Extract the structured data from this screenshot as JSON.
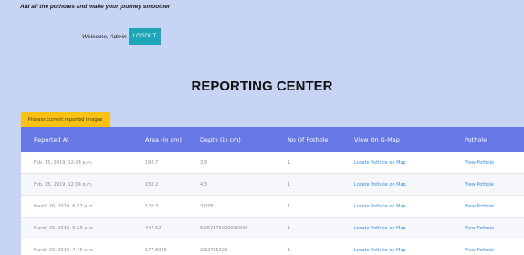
{
  "header": {
    "tagline": "Aid all the potholes and make your journey smoother",
    "welcome_text": "Welcome, Admin",
    "logout_label": "LOGOUT"
  },
  "main": {
    "title": "REPORTING CENTER",
    "process_button_label": "Process current reported images"
  },
  "table": {
    "columns": [
      "Reported At",
      "Area (in cm)",
      "Depth (in cm)",
      "No Of Pothole",
      "View On G-Map",
      "Pothole"
    ],
    "rows": [
      [
        "Feb. 15, 2019, 12:04 p.m.",
        "188.7",
        "3.9",
        "1",
        "Locate Pothole on Map",
        "View Pothole"
      ],
      [
        "Feb. 15, 2019, 12:04 p.m.",
        "158.2",
        "4.3",
        "1",
        "Locate Pothole on Map",
        "View Pothole"
      ],
      [
        "March 20, 2019, 6:17 a.m.",
        "120.3",
        "3.078",
        "1",
        "Locate Pothole on Map",
        "View Pothole"
      ],
      [
        "March 20, 2019, 6:23 a.m.",
        "447.62",
        "6.057575999999999",
        "1",
        "Locate Pothole on Map",
        "View Pothole"
      ],
      [
        "March 20, 2019, 7:45 a.m.",
        "177.8946",
        "2.82765322",
        "1",
        "Locate Pothole on Map",
        "View Pothole"
      ]
    ]
  },
  "colors": {
    "background": "#c7d4f4",
    "table_header": "#6777e3",
    "logout_button": "#1ea6b8",
    "process_button": "#f7c115",
    "link": "#3a8fe0"
  }
}
